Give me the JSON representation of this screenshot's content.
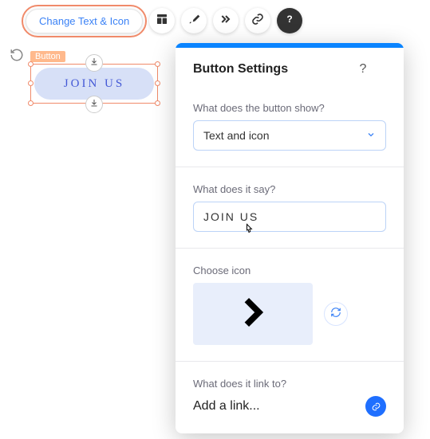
{
  "toolbar": {
    "change_text_label": "Change Text & Icon"
  },
  "canvas": {
    "badge": "Button",
    "button_text": "JOIN US"
  },
  "panel": {
    "title": "Button Settings",
    "sections": {
      "show": {
        "label": "What does the button show?",
        "value": "Text and icon"
      },
      "say": {
        "label": "What does it say?",
        "value": "JOIN US"
      },
      "icon": {
        "label": "Choose icon",
        "icon_name": "chevron-right"
      },
      "link": {
        "label": "What does it link to?",
        "placeholder": "Add a link..."
      }
    }
  }
}
